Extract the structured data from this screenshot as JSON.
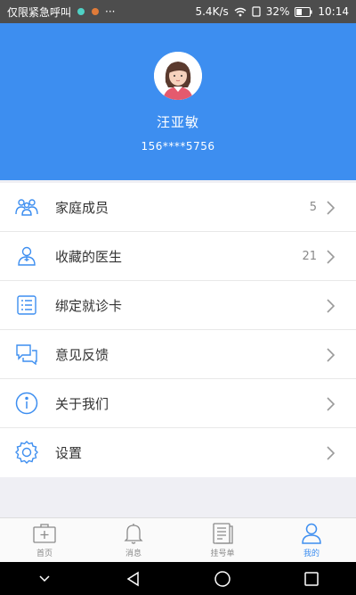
{
  "status_bar": {
    "carrier": "仅限紧急呼叫",
    "speed": "5.4K/s",
    "battery": "32%",
    "time": "10:14"
  },
  "profile": {
    "name": "汪亚敏",
    "phone": "156****5756"
  },
  "menu": [
    {
      "label": "家庭成员",
      "count": "5",
      "icon": "family-icon"
    },
    {
      "label": "收藏的医生",
      "count": "21",
      "icon": "doctor-icon"
    },
    {
      "label": "绑定就诊卡",
      "count": "",
      "icon": "card-icon"
    },
    {
      "label": "意见反馈",
      "count": "",
      "icon": "feedback-icon"
    },
    {
      "label": "关于我们",
      "count": "",
      "icon": "info-icon"
    },
    {
      "label": "设置",
      "count": "",
      "icon": "gear-icon"
    }
  ],
  "tabs": [
    {
      "label": "首页",
      "icon": "home-icon",
      "active": false
    },
    {
      "label": "消息",
      "icon": "bell-icon",
      "active": false
    },
    {
      "label": "挂号单",
      "icon": "list-icon",
      "active": false
    },
    {
      "label": "我的",
      "icon": "user-icon",
      "active": true
    }
  ],
  "colors": {
    "accent": "#3d8ef0",
    "status_bar": "#4d4d4d",
    "background": "#efeff4"
  }
}
